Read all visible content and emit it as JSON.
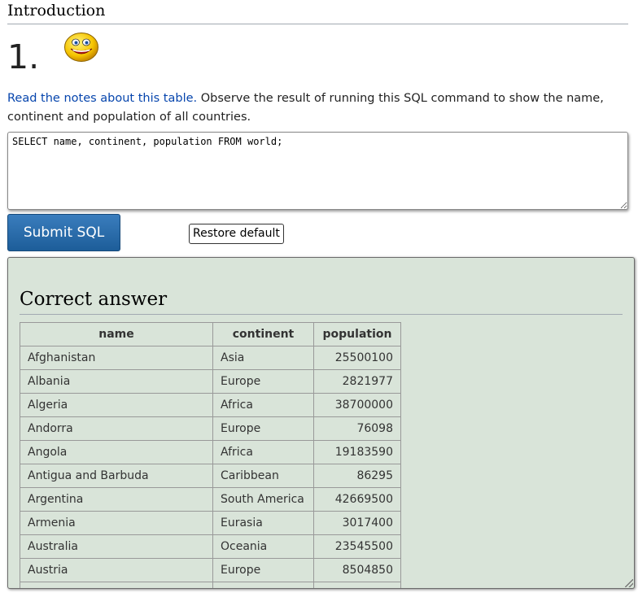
{
  "section": {
    "title": "Introduction"
  },
  "question": {
    "number": "1.",
    "link_text": "Read the notes about this table.",
    "text": " Observe the result of running this SQL command to show the name, continent and population of all countries."
  },
  "editor": {
    "sql": "SELECT name, continent, population FROM world;"
  },
  "buttons": {
    "submit_label": "Submit SQL",
    "restore_label": "Restore default"
  },
  "result": {
    "heading": "Correct answer",
    "columns": [
      "name",
      "continent",
      "population"
    ],
    "rows": [
      [
        "Afghanistan",
        "Asia",
        "25500100"
      ],
      [
        "Albania",
        "Europe",
        "2821977"
      ],
      [
        "Algeria",
        "Africa",
        "38700000"
      ],
      [
        "Andorra",
        "Europe",
        "76098"
      ],
      [
        "Angola",
        "Africa",
        "19183590"
      ],
      [
        "Antigua and Barbuda",
        "Caribbean",
        "86295"
      ],
      [
        "Argentina",
        "South America",
        "42669500"
      ],
      [
        "Armenia",
        "Eurasia",
        "3017400"
      ],
      [
        "Australia",
        "Oceania",
        "23545500"
      ],
      [
        "Austria",
        "Europe",
        "8504850"
      ],
      [
        "",
        "",
        ""
      ]
    ]
  },
  "colors": {
    "link": "#0645ad",
    "submit_button": "#2a6eae",
    "result_panel": "#d9e4d9"
  }
}
